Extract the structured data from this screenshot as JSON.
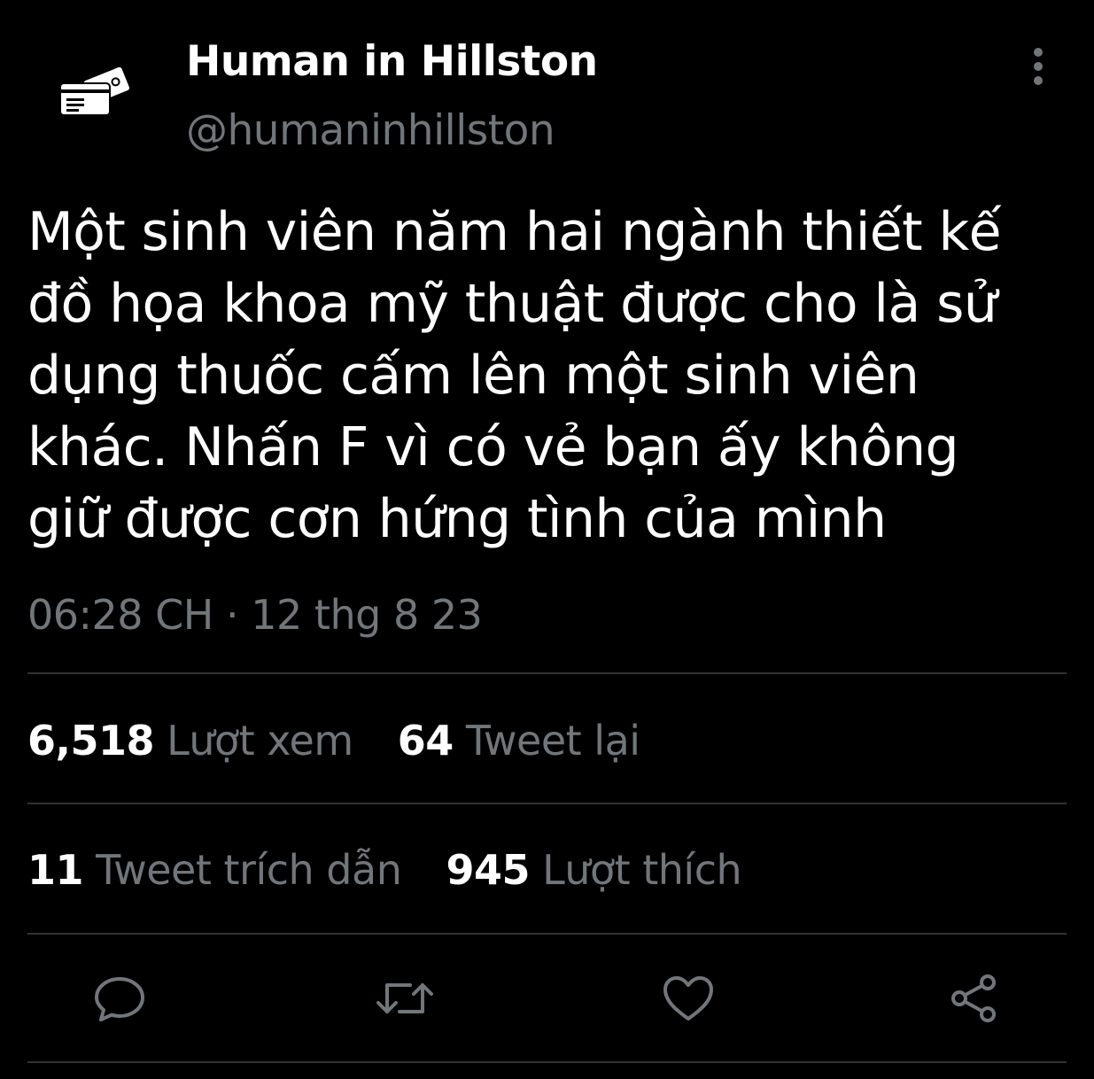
{
  "author": {
    "name": "Human in Hillston",
    "handle": "@humaninhillston",
    "avatar_icon": "credit-card-icon"
  },
  "tweet": {
    "text": "Một sinh viên năm hai ngành thiết kế\nđồ họa khoa mỹ thuật được cho là sử\ndụng thuốc cấm lên một sinh viên\nkhác. Nhấn F vì có vẻ bạn ấy không\ngiữ được cơn hứng tình của mình",
    "time": "06:28 CH",
    "separator": "·",
    "date": "12 thg 8 23"
  },
  "stats": {
    "views": {
      "count": "6,518",
      "label": "Lượt xem"
    },
    "retweets": {
      "count": "64",
      "label": "Tweet lại"
    },
    "quotes": {
      "count": "11",
      "label": "Tweet trích dẫn"
    },
    "likes": {
      "count": "945",
      "label": "Lượt thích"
    }
  },
  "actions": [
    "reply-icon",
    "retweet-icon",
    "like-icon",
    "share-icon"
  ],
  "colors": {
    "background": "#000000",
    "text": "#ffffff",
    "secondary": "#71767b",
    "divider": "#2f3336"
  }
}
